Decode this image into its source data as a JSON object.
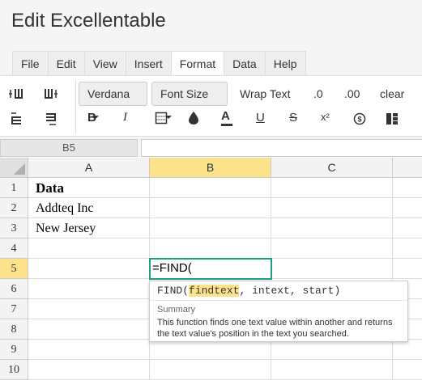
{
  "app": {
    "title": "Edit Excellentable"
  },
  "menu": {
    "tabs": [
      {
        "label": "File"
      },
      {
        "label": "Edit"
      },
      {
        "label": "View"
      },
      {
        "label": "Insert"
      },
      {
        "label": "Format",
        "active": true
      },
      {
        "label": "Data"
      },
      {
        "label": "Help"
      }
    ]
  },
  "toolbar": {
    "font_dropdown": "Verdana",
    "size_dropdown": "Font Size",
    "wrap_text": "Wrap Text",
    "dec_decimal": ".0",
    "inc_decimal": ".00",
    "clear": "clear",
    "bold": "B",
    "italic": "I",
    "font_color": "A",
    "underline": "U",
    "strike": "S",
    "superscript": "x²",
    "currency": "$",
    "icons": [
      "insert-col-left-icon",
      "insert-col-right-icon",
      "insert-row-above-icon",
      "insert-row-below-icon",
      "border-icon",
      "fill-color-icon",
      "merge-icon"
    ]
  },
  "formula_bar": {
    "cell_ref": "B5",
    "value": ""
  },
  "grid": {
    "columns": [
      "A",
      "B",
      "C"
    ],
    "selected_column": "B",
    "rows": [
      "1",
      "2",
      "3",
      "4",
      "5",
      "6",
      "7",
      "8",
      "9",
      "10"
    ],
    "selected_row": "5",
    "cells": {
      "A1": "Data",
      "A2": "Addteq Inc",
      "A3": "New Jersey",
      "B5": "=FIND("
    }
  },
  "autocomplete": {
    "fn_name": "FIND(",
    "param_active": "findtext",
    "params_rest": ", intext, start)",
    "summary_label": "Summary",
    "summary_text": "This function finds one text value within another and returns the text value's position in the text you searched."
  },
  "colors": {
    "accent": "#1f9e84",
    "selected_header": "#fce28a",
    "highlight": "#fce28a"
  }
}
